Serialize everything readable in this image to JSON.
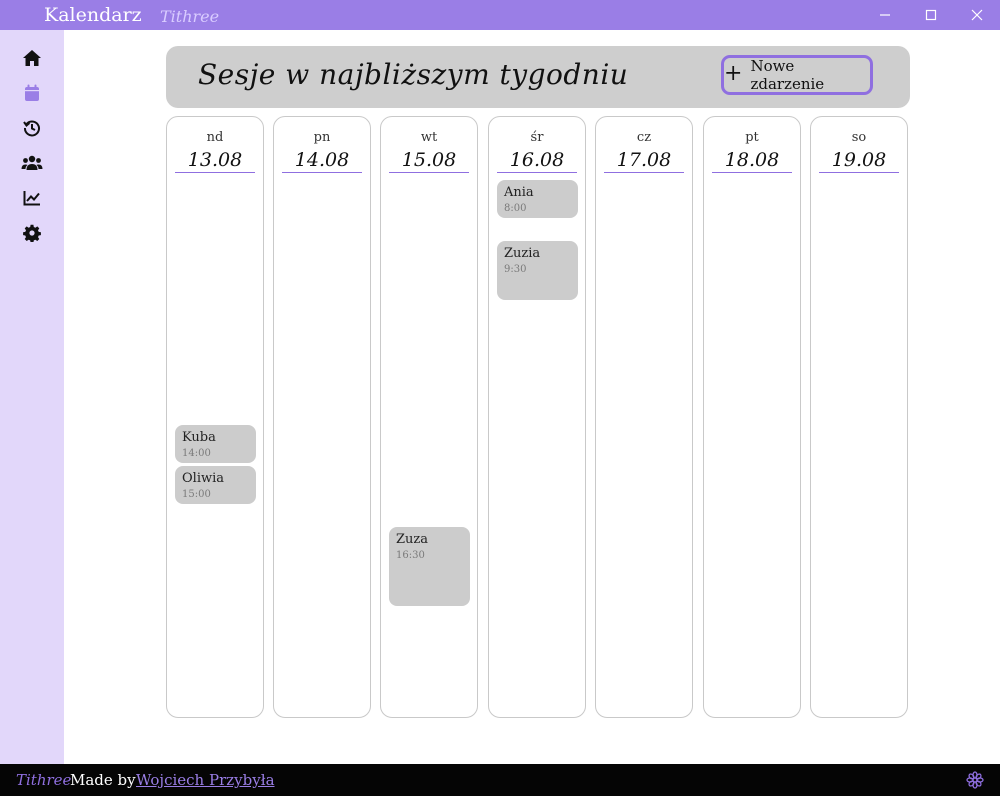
{
  "window": {
    "title": "Kalendarz",
    "brand": "Tithree",
    "controls": [
      "minimize-icon",
      "maximize-icon",
      "close-icon"
    ]
  },
  "sidebar": {
    "items": [
      {
        "icon": "home-icon",
        "active": false
      },
      {
        "icon": "calendar-icon",
        "active": true
      },
      {
        "icon": "history-icon",
        "active": false
      },
      {
        "icon": "users-icon",
        "active": false
      },
      {
        "icon": "chart-line-icon",
        "active": false
      },
      {
        "icon": "gear-icon",
        "active": false
      }
    ]
  },
  "header": {
    "title": "Sesje w najbliższym tygodniu",
    "new_event_label": "Nowe zdarzenie",
    "new_event_icon": "plus-icon"
  },
  "days": [
    {
      "name": "nd",
      "date": "13.08",
      "events": [
        {
          "name": "Kuba",
          "time": "14:00"
        },
        {
          "name": "Oliwia",
          "time": "15:00"
        }
      ]
    },
    {
      "name": "pn",
      "date": "14.08",
      "events": []
    },
    {
      "name": "wt",
      "date": "15.08",
      "events": [
        {
          "name": "Zuza",
          "time": "16:30"
        }
      ]
    },
    {
      "name": "śr",
      "date": "16.08",
      "events": [
        {
          "name": "Ania",
          "time": "8:00"
        },
        {
          "name": "Zuzia",
          "time": "9:30"
        }
      ]
    },
    {
      "name": "cz",
      "date": "17.08",
      "events": []
    },
    {
      "name": "pt",
      "date": "18.08",
      "events": []
    },
    {
      "name": "so",
      "date": "19.08",
      "events": []
    }
  ],
  "footer": {
    "brand": "Tithree",
    "made_by": "Made by",
    "author": "Wojciech Przybyła",
    "logo_icon": "flower-logo-icon"
  },
  "colors": {
    "accent": "#9a7ee6",
    "sidebar_bg": "#e2d7fa",
    "panel_gray": "#cecece",
    "footer_bg": "#050505"
  }
}
